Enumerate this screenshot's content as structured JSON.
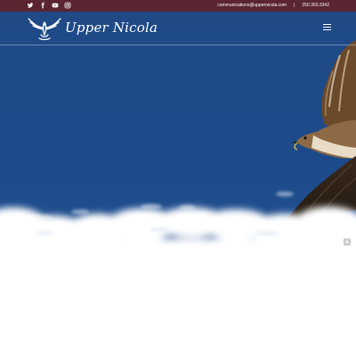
{
  "topbar": {
    "social": [
      {
        "icon": "twitter-icon",
        "label": "Twitter"
      },
      {
        "icon": "facebook-icon",
        "label": "Facebook"
      },
      {
        "icon": "youtube-icon",
        "label": "YouTube"
      },
      {
        "icon": "instagram-icon",
        "label": "Instagram"
      }
    ],
    "email": "communications@uppernicola.com",
    "separator": "|",
    "phone": "250.350.3342"
  },
  "header": {
    "brand": "Upper Nicola",
    "logo_icon": "eagle-logo-icon",
    "menu_icon": "hamburger-menu-icon"
  },
  "hero": {
    "image": "hawk-in-flight-over-clouds",
    "scroll_control_icon": "scroll-up-icon"
  },
  "colors": {
    "topbar": "#5a2430",
    "sky": "#1f4a86",
    "text": "#ffffff"
  }
}
